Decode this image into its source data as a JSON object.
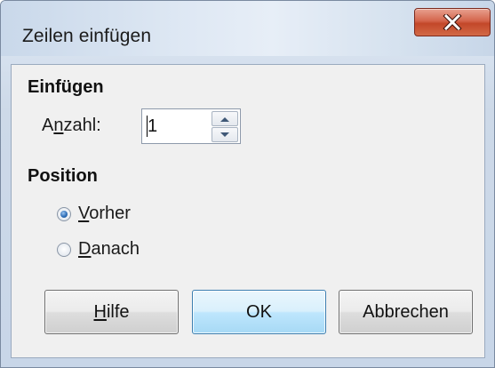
{
  "window": {
    "title": "Zeilen einfügen",
    "close_glyph": "✕"
  },
  "insert_section": {
    "title": "Einfügen",
    "count_label_before": "A",
    "count_label_mnemonic": "n",
    "count_label_after": "zahl:",
    "count_value": "1"
  },
  "position_section": {
    "title": "Position",
    "options": [
      {
        "mnemonic": "V",
        "rest": "orher",
        "checked": true
      },
      {
        "mnemonic": "D",
        "rest": "anach",
        "checked": false
      }
    ]
  },
  "buttons": {
    "help_mnemonic": "H",
    "help_rest": "ilfe",
    "ok_label": "OK",
    "cancel_label": "Abbrechen"
  },
  "icons": {
    "close": "close-icon",
    "spin_up": "arrow-up-icon",
    "spin_down": "arrow-down-icon"
  }
}
